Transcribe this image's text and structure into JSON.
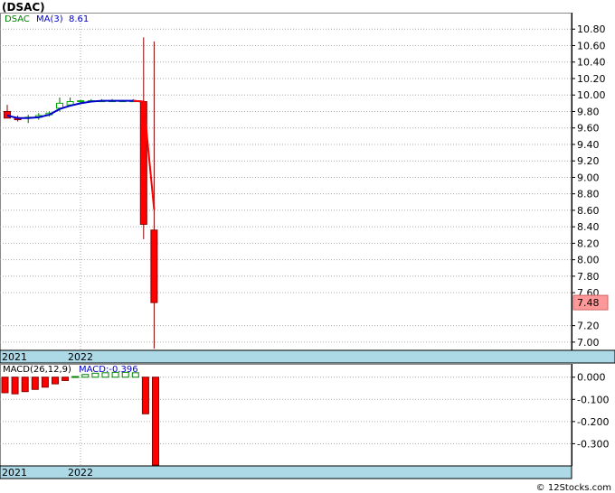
{
  "title": "(DSAC)",
  "footer": "© 12Stocks.com",
  "colors": {
    "up": "#00aa00",
    "down": "#ff0000",
    "ma": "#0000cc",
    "macd_pos": "#008000",
    "macd_neg": "#ff0000",
    "time_bar": "#add8e6",
    "last_bg": "#ff9999"
  },
  "chart_data": [
    {
      "type": "candlestick",
      "legend": {
        "ticker": "DSAC",
        "ma": "MA(3)",
        "ma_value": "8.61"
      },
      "last_price": "7.48",
      "ylim": [
        6.9,
        11.0
      ],
      "y_ticks": [
        "10.80",
        "10.60",
        "10.40",
        "10.20",
        "10.00",
        "9.80",
        "9.60",
        "9.40",
        "9.20",
        "9.00",
        "8.80",
        "8.60",
        "8.40",
        "8.20",
        "8.00",
        "7.80",
        "7.60",
        "7.20",
        "7.00"
      ],
      "x_labels": [
        "2021",
        "2022"
      ],
      "candles": [
        {
          "o": 9.8,
          "h": 9.88,
          "l": 9.72,
          "c": 9.72
        },
        {
          "o": 9.72,
          "h": 9.75,
          "l": 9.68,
          "c": 9.7
        },
        {
          "o": 9.72,
          "h": 9.76,
          "l": 9.66,
          "c": 9.73
        },
        {
          "o": 9.73,
          "h": 9.78,
          "l": 9.7,
          "c": 9.75
        },
        {
          "o": 9.76,
          "h": 9.8,
          "l": 9.74,
          "c": 9.78
        },
        {
          "o": 9.84,
          "h": 9.97,
          "l": 9.8,
          "c": 9.9
        },
        {
          "o": 9.88,
          "h": 9.97,
          "l": 9.86,
          "c": 9.92
        },
        {
          "o": 9.92,
          "h": 9.94,
          "l": 9.9,
          "c": 9.93
        },
        {
          "o": 9.92,
          "h": 9.95,
          "l": 9.91,
          "c": 9.93
        },
        {
          "o": 9.93,
          "h": 9.95,
          "l": 9.92,
          "c": 9.93
        },
        {
          "o": 9.93,
          "h": 9.95,
          "l": 9.92,
          "c": 9.93
        },
        {
          "o": 9.93,
          "h": 9.94,
          "l": 9.92,
          "c": 9.93
        },
        {
          "o": 9.93,
          "h": 9.95,
          "l": 9.92,
          "c": 9.93
        },
        {
          "o": 9.92,
          "h": 10.7,
          "l": 8.25,
          "c": 8.43
        },
        {
          "o": 8.36,
          "h": 10.65,
          "l": 6.92,
          "c": 7.48
        }
      ],
      "ma3": [
        9.75,
        9.72,
        9.72,
        9.73,
        9.76,
        9.83,
        9.87,
        9.9,
        9.92,
        9.93,
        9.93,
        9.93,
        9.93,
        9.92,
        8.61
      ]
    },
    {
      "type": "bar",
      "legend": {
        "name": "MACD(26,12,9)",
        "value_label": "MACD:-0.396"
      },
      "ylim": [
        -0.4,
        0.06
      ],
      "y_ticks": [
        "0.000",
        "-0.100",
        "-0.200",
        "-0.300"
      ],
      "x_labels": [
        "2021",
        "2022"
      ],
      "values": [
        -0.07,
        -0.075,
        -0.065,
        -0.055,
        -0.045,
        -0.03,
        -0.015,
        0.003,
        0.012,
        0.018,
        0.02,
        0.022,
        0.022,
        0.02,
        -0.165,
        -0.396
      ]
    }
  ]
}
